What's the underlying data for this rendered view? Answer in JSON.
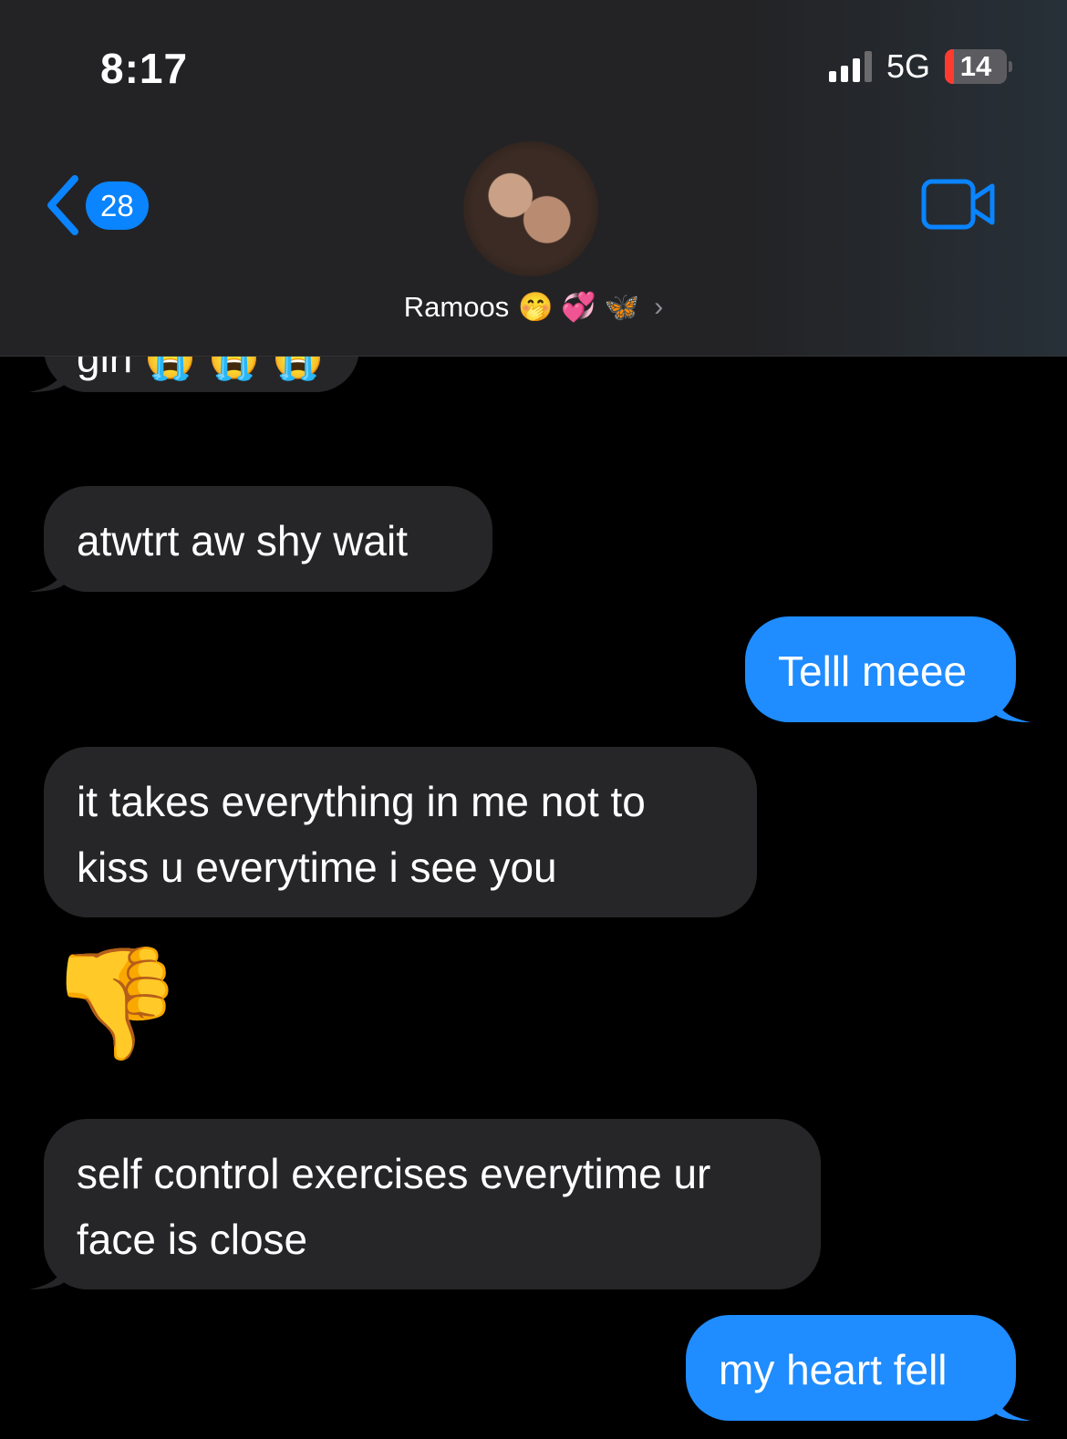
{
  "status_bar": {
    "time": "8:17",
    "network": "5G",
    "battery": "14",
    "battery_level": 0.14
  },
  "nav": {
    "back_count": "28",
    "contact_name": "Ramoos",
    "contact_emojis": "🤭 💞 🦋"
  },
  "messages": [
    {
      "side": "received",
      "text": "girl 😭 😭 😭"
    },
    {
      "side": "received",
      "text": "atwtrt aw shy wait"
    },
    {
      "side": "sent",
      "text": "Telll meee"
    },
    {
      "side": "received",
      "text": "it takes everything in me not to kiss u everytime i see you"
    },
    {
      "side": "received",
      "text": "👎"
    },
    {
      "side": "received",
      "text": "self control exercises everytime ur face is close"
    },
    {
      "side": "sent",
      "text": "my heart fell"
    }
  ],
  "colors": {
    "accent": "#0a84ff",
    "sent_bubble": "#1f8cff",
    "received_bubble": "#262628"
  }
}
